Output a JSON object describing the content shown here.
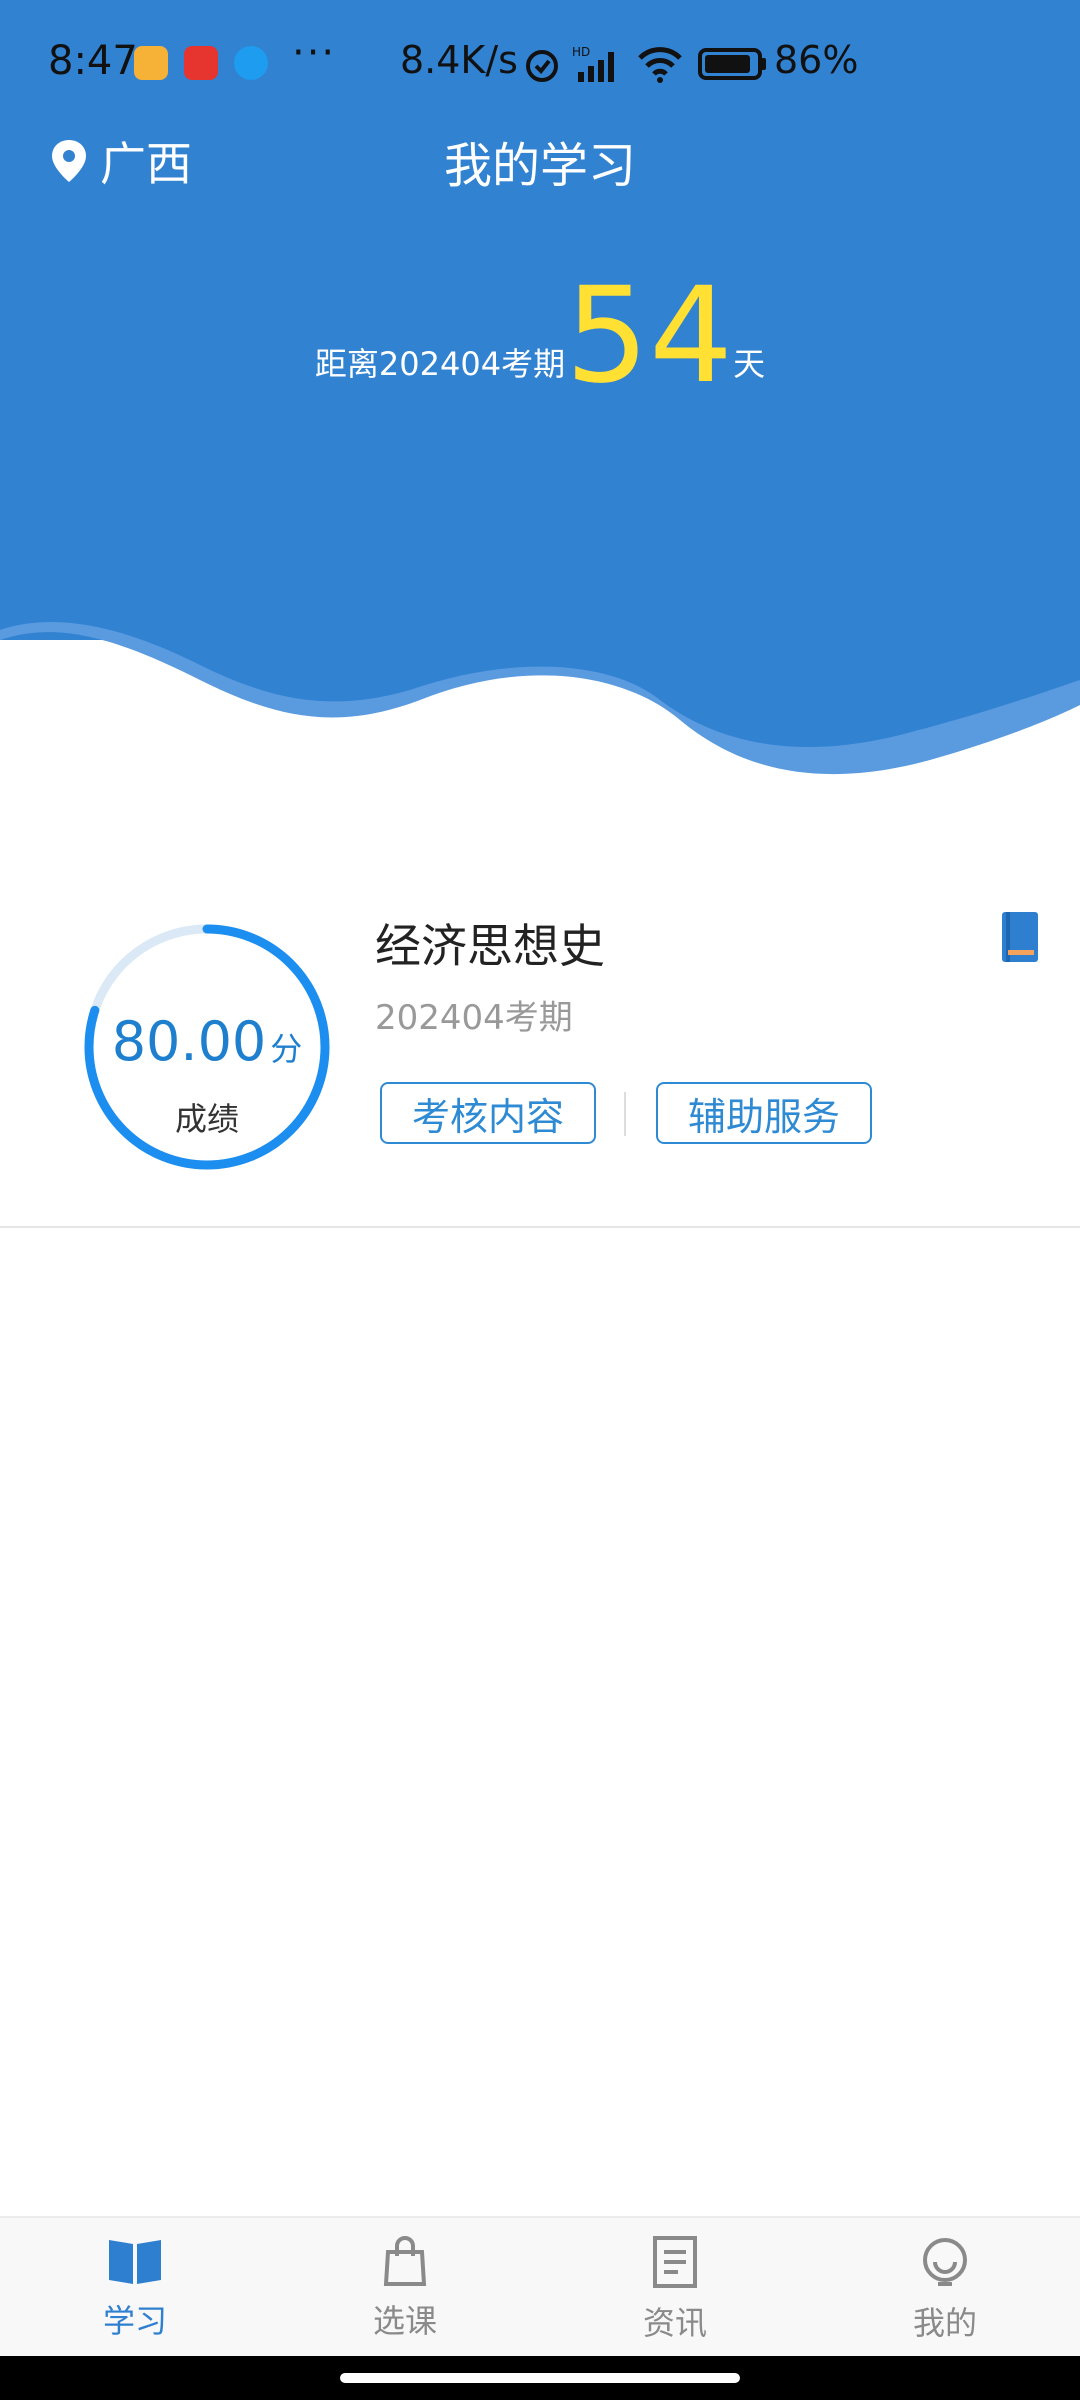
{
  "status_bar": {
    "time": "8:47",
    "dots": "···",
    "network_speed": "8.4K/s",
    "battery": "86%",
    "icons": [
      "notes-app-icon",
      "kandian-app-icon",
      "browser-app-icon",
      "alarm-icon",
      "hd-signal-icon",
      "wifi-icon",
      "battery-icon"
    ]
  },
  "header": {
    "location": "广西",
    "title": "我的学习",
    "countdown_prefix": "距离202404考期",
    "countdown_days": "54",
    "countdown_unit": "天",
    "colors": {
      "background": "#3282d2",
      "accent_number": "#ffe033"
    }
  },
  "course": {
    "name": "经济思想史",
    "term": "202404考期",
    "score": "80.00",
    "score_unit": "分",
    "score_label": "成绩",
    "buttons": {
      "exam_content": "考核内容",
      "support_service": "辅助服务"
    }
  },
  "tabs": [
    {
      "label": "学习",
      "icon": "open-book-icon",
      "active": true
    },
    {
      "label": "选课",
      "icon": "shopping-bag-icon",
      "active": false
    },
    {
      "label": "资讯",
      "icon": "document-icon",
      "active": false
    },
    {
      "label": "我的",
      "icon": "smiley-icon",
      "active": false
    }
  ]
}
